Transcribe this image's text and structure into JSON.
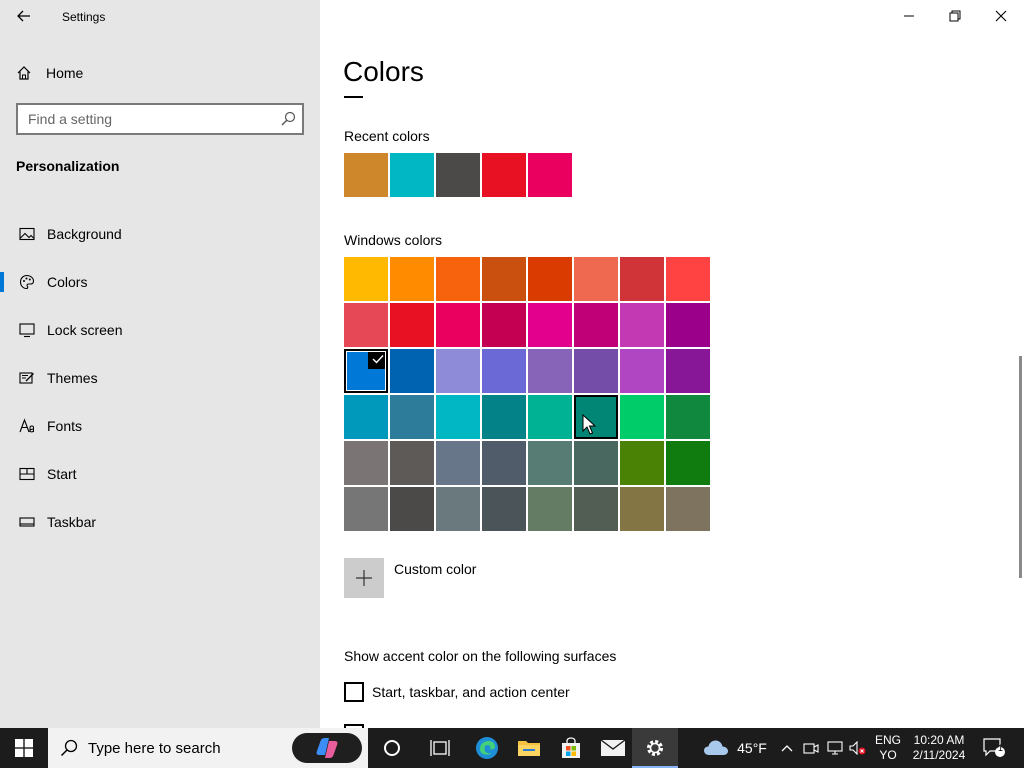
{
  "window": {
    "title": "Settings"
  },
  "sidebar": {
    "home_label": "Home",
    "search_placeholder": "Find a setting",
    "section": "Personalization",
    "items": [
      {
        "label": "Background",
        "icon": "picture-icon",
        "active": false
      },
      {
        "label": "Colors",
        "icon": "palette-icon",
        "active": true
      },
      {
        "label": "Lock screen",
        "icon": "lock-screen-icon",
        "active": false
      },
      {
        "label": "Themes",
        "icon": "themes-icon",
        "active": false
      },
      {
        "label": "Fonts",
        "icon": "fonts-icon",
        "active": false
      },
      {
        "label": "Start",
        "icon": "start-icon",
        "active": false
      },
      {
        "label": "Taskbar",
        "icon": "taskbar-icon",
        "active": false
      }
    ]
  },
  "main": {
    "title": "Colors",
    "recent_label": "Recent colors",
    "recent_colors": [
      "#CE882B",
      "#00B7C3",
      "#4C4A48",
      "#E81123",
      "#EA005E"
    ],
    "windows_label": "Windows colors",
    "windows_colors": [
      [
        "#FFB900",
        "#FF8C00",
        "#F7630C",
        "#CA5010",
        "#DA3B01",
        "#EF6950",
        "#D13438",
        "#FF4343"
      ],
      [
        "#E74856",
        "#E81123",
        "#EA005E",
        "#C30052",
        "#E3008C",
        "#BF0077",
        "#C239B3",
        "#9A0089"
      ],
      [
        "#0078D7",
        "#0063B1",
        "#8E8CD8",
        "#6B69D6",
        "#8764B8",
        "#744DA9",
        "#B146C2",
        "#881798"
      ],
      [
        "#0099BC",
        "#2D7D9A",
        "#00B7C3",
        "#038387",
        "#00B294",
        "#018574",
        "#00CC6A",
        "#10893E"
      ],
      [
        "#7A7574",
        "#5D5A58",
        "#68768A",
        "#515C6B",
        "#567C73",
        "#486860",
        "#498205",
        "#107C10"
      ],
      [
        "#767676",
        "#4C4A48",
        "#69797E",
        "#4A5459",
        "#647C64",
        "#525E54",
        "#847545",
        "#7E735F"
      ]
    ],
    "selected_color": "#0078D7",
    "hovered_color": "#018574",
    "custom_color_label": "Custom color",
    "surfaces_label": "Show accent color on the following surfaces",
    "checkbox_start_label": "Start, taskbar, and action center"
  },
  "taskbar": {
    "search_placeholder": "Type here to search",
    "weather": "45°F",
    "lang_line1": "ENG",
    "lang_line2": "YO",
    "time": "10:20 AM",
    "date": "2/11/2024",
    "notification_count": "1"
  }
}
